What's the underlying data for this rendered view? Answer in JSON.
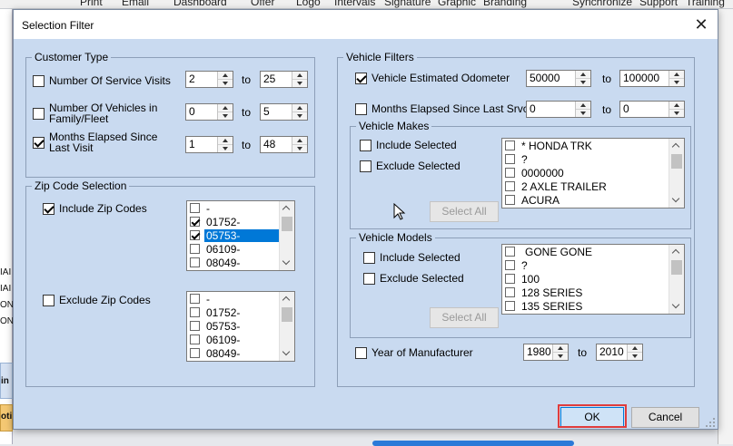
{
  "background": {
    "menu_fragments": [
      "Print",
      "Email",
      "Dashboard",
      "Offer",
      "Logo",
      "Intervals",
      "Signature",
      "Graphic",
      "Branding",
      "Synchronize",
      "Support",
      "Training"
    ],
    "left_fragments": [
      "IAI",
      "IAI",
      "ON",
      "ON",
      "in",
      "oti"
    ]
  },
  "dialog": {
    "title": "Selection Filter",
    "close_glyph": "✕",
    "customer_type": {
      "legend": "Customer Type",
      "rows": [
        {
          "label": "Number Of Service Visits",
          "checked": false,
          "from": "2",
          "to": "25"
        },
        {
          "label": "Number Of Vehicles in Family/Fleet",
          "checked": false,
          "from": "0",
          "to": "5"
        },
        {
          "label": "Months Elapsed Since Last Visit",
          "checked": true,
          "from": "1",
          "to": "48"
        }
      ],
      "to_label": "to"
    },
    "zip_codes": {
      "legend": "Zip Code Selection",
      "include_label": "Include Zip Codes",
      "include_checked": true,
      "include_items": [
        {
          "text": "-",
          "checked": false,
          "selected": false
        },
        {
          "text": "01752-",
          "checked": true,
          "selected": false
        },
        {
          "text": "05753-",
          "checked": true,
          "selected": true
        },
        {
          "text": "06109-",
          "checked": false,
          "selected": false
        },
        {
          "text": "08049-",
          "checked": false,
          "selected": false
        }
      ],
      "exclude_label": "Exclude Zip Codes",
      "exclude_checked": false,
      "exclude_items": [
        {
          "text": "-",
          "checked": false
        },
        {
          "text": "01752-",
          "checked": false
        },
        {
          "text": "05753-",
          "checked": false
        },
        {
          "text": "06109-",
          "checked": false
        },
        {
          "text": "08049-",
          "checked": false
        }
      ]
    },
    "vehicle_filters": {
      "legend": "Vehicle Filters",
      "odometer": {
        "label": "Vehicle Estimated Odometer",
        "checked": true,
        "from": "50000",
        "to": "100000"
      },
      "months_srvc": {
        "label": "Months Elapsed Since Last Srvc",
        "checked": false,
        "from": "0",
        "to": "0"
      },
      "to_label": "to",
      "makes": {
        "legend": "Vehicle Makes",
        "include_label": "Include Selected",
        "exclude_label": "Exclude Selected",
        "select_all": "Select All",
        "items": [
          "* HONDA TRK",
          "?",
          "0000000",
          "2 AXLE TRAILER",
          "ACURA"
        ]
      },
      "models": {
        "legend": "Vehicle Models",
        "include_label": "Include Selected",
        "exclude_label": "Exclude Selected",
        "select_all": "Select All",
        "items": [
          "GONE GONE",
          "?",
          "100",
          "128 SERIES",
          "135 SERIES"
        ]
      },
      "year": {
        "label": "Year of Manufacturer",
        "checked": false,
        "from": "1980",
        "to": "2010"
      }
    },
    "ok_label": "OK",
    "cancel_label": "Cancel",
    "colors": {
      "highlight": "#e03c3c",
      "selection": "#0078d7",
      "client_bg": "#c9daf0"
    }
  }
}
